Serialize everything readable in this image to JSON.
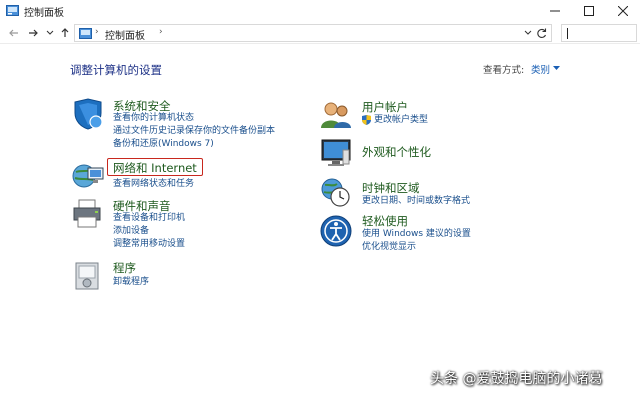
{
  "window": {
    "title": "控制面板"
  },
  "address_bar": {
    "crumb": "控制面板",
    "sep": "›"
  },
  "search": {
    "value": ""
  },
  "main": {
    "heading": "调整计算机的设置",
    "view_by_label": "查看方式:",
    "view_by_value": "类别"
  },
  "left": [
    {
      "title": "系统和安全",
      "links": [
        "查看你的计算机状态",
        "通过文件历史记录保存你的文件备份副本",
        "备份和还原(Windows 7)"
      ]
    },
    {
      "title": "网络和 Internet",
      "links": [
        "查看网络状态和任务"
      ]
    },
    {
      "title": "硬件和声音",
      "links": [
        "查看设备和打印机",
        "添加设备",
        "调整常用移动设置"
      ]
    },
    {
      "title": "程序",
      "links": [
        "卸载程序"
      ]
    }
  ],
  "right": [
    {
      "title": "用户帐户",
      "links": [
        "更改帐户类型"
      ]
    },
    {
      "title": "外观和个性化",
      "links": []
    },
    {
      "title": "时钟和区域",
      "links": [
        "更改日期、时间或数字格式"
      ]
    },
    {
      "title": "轻松使用",
      "links": [
        "使用 Windows 建议的设置",
        "优化视觉显示"
      ]
    }
  ],
  "watermark": "头条 @爱鼓捣电脑的小诸葛",
  "colors": {
    "highlight_border": "#c8281e",
    "title_green": "#1e5a1e",
    "link_blue": "#1a4f8c",
    "heading_blue": "#1e3287"
  }
}
